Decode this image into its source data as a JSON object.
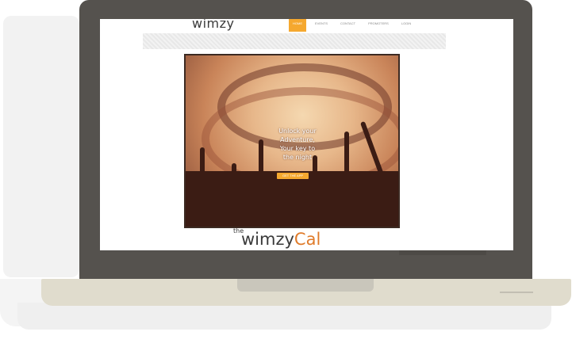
{
  "site": {
    "logo": "wimzy",
    "nav": [
      "HOME",
      "EVENTS",
      "CONTACT",
      "PROMOTERS",
      "LOGIN"
    ],
    "hero": {
      "line1": "Unlock your",
      "line2": "Adventure,",
      "line3": "Your key to",
      "line4": "the night",
      "button": "GET THE APP"
    },
    "footer_logo": {
      "prefix": "the",
      "word": "wimzy",
      "suffix": "Cal"
    }
  },
  "colors": {
    "accent": "#f5a82f",
    "laptop_bezel": "#55524e",
    "laptop_base": "#e0dccd",
    "cal_orange": "#e07b2a"
  }
}
